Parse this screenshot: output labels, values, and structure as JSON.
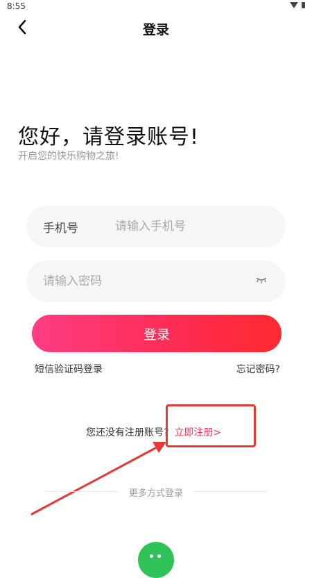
{
  "status_bar": {
    "time": "8:55"
  },
  "header": {
    "title": "登录"
  },
  "greeting": "您好，请登录账号!",
  "subtitle": "开启您的快乐购物之旅!",
  "phone_field": {
    "label": "手机号",
    "placeholder": "请输入手机号"
  },
  "password_field": {
    "placeholder": "请输入密码"
  },
  "login_button": "登录",
  "sms_login": "短信验证码登录",
  "forgot_password": "忘记密码?",
  "register": {
    "prompt": "您还没有注册账号?",
    "link": "立即注册>"
  },
  "more_methods": "更多方式登录",
  "colors": {
    "accent": "#ff2d55",
    "button_gradient_start": "#ff3d82",
    "button_gradient_end": "#ff2a2f",
    "annotation": "#e53935",
    "wechat": "#2fc357"
  },
  "icons": [
    "back-arrow-icon",
    "wifi-icon",
    "battery-icon",
    "eye-closed-icon",
    "wechat-icon"
  ]
}
